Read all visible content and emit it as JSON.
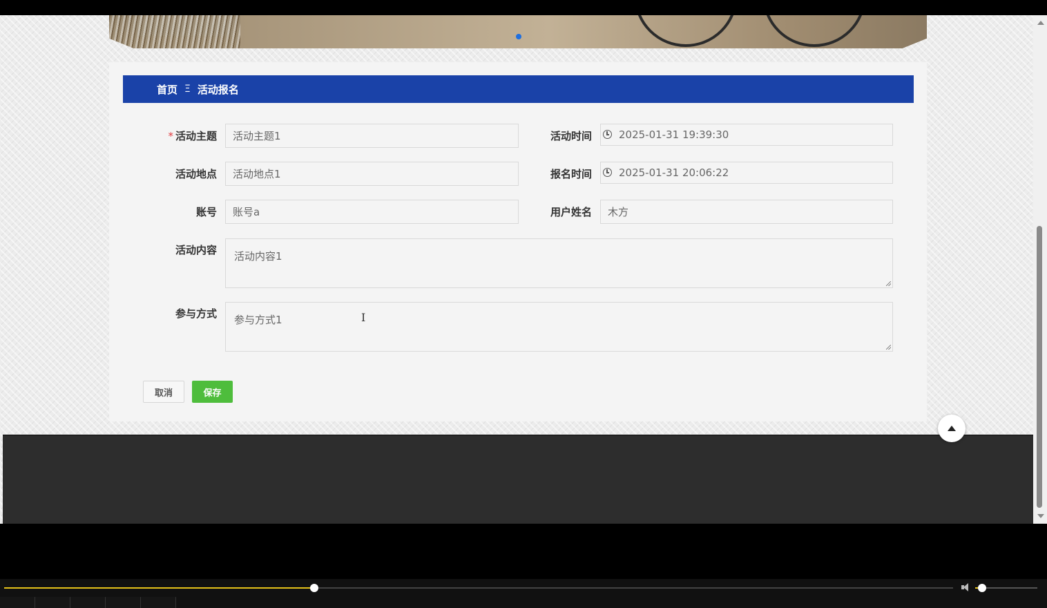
{
  "breadcrumb": {
    "home": "首页",
    "separator": "Ξ",
    "current": "活动报名"
  },
  "form": {
    "activity_theme": {
      "label": "活动主题",
      "required_mark": "*",
      "value": "活动主题1"
    },
    "activity_time": {
      "label": "活动时间",
      "value": "2025-01-31 19:39:30"
    },
    "activity_location": {
      "label": "活动地点",
      "value": "活动地点1"
    },
    "signup_time": {
      "label": "报名时间",
      "value": "2025-01-31 20:06:22"
    },
    "account": {
      "label": "账号",
      "value": "账号a"
    },
    "user_name": {
      "label": "用户姓名",
      "value": "木方"
    },
    "activity_content": {
      "label": "活动内容",
      "value": "活动内容1"
    },
    "participation_method": {
      "label": "参与方式",
      "value": "参与方式1"
    }
  },
  "buttons": {
    "cancel": "取消",
    "save": "保存"
  },
  "colors": {
    "breadcrumb_bg": "#1a42a8",
    "save_button": "#4ebd3c",
    "required": "#e0393e",
    "progress": "#e6c21a"
  },
  "player": {
    "progress_fraction": 0.327,
    "volume_fraction": 0.11
  },
  "icons": {
    "clock": "clock-icon",
    "back_to_top": "arrow-up-icon",
    "volume": "volume-icon"
  }
}
